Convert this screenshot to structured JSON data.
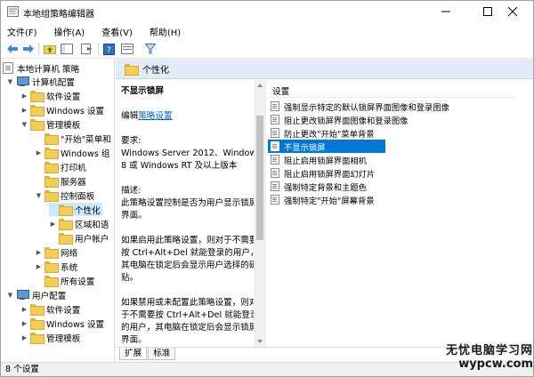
{
  "window": {
    "title": "本地组策略编辑器"
  },
  "menu": [
    "文件(F)",
    "操作(A)",
    "查看(V)",
    "帮助(H)"
  ],
  "tree": {
    "root": "本地计算机 策略",
    "items": [
      {
        "label": "计算机配置"
      },
      {
        "label": "软件设置"
      },
      {
        "label": "Windows 设置"
      },
      {
        "label": "管理模板"
      },
      {
        "label": "\"开始\"菜单和"
      },
      {
        "label": "Windows 组"
      },
      {
        "label": "打印机"
      },
      {
        "label": "服务器"
      },
      {
        "label": "控制面板"
      },
      {
        "label": "个性化"
      },
      {
        "label": "区域和语"
      },
      {
        "label": "用户帐户"
      },
      {
        "label": "网络"
      },
      {
        "label": "系统"
      },
      {
        "label": "所有设置"
      },
      {
        "label": "用户配置"
      },
      {
        "label": "软件设置"
      },
      {
        "label": "Windows 设置"
      },
      {
        "label": "管理模板"
      }
    ]
  },
  "header": {
    "title": "个性化"
  },
  "description": {
    "title": "不显示锁屏",
    "edit_prefix": "编辑",
    "edit_link": "策略设置",
    "requirements_label": "要求:",
    "requirements_text": "Windows Server 2012、Windows 8 或 Windows RT 及以上版本",
    "desc_label": "描述:",
    "desc_text": "此策略设置控制是否为用户显示锁屏界面。",
    "p1": "如果启用此策略设置，则对于不需要按 Ctrl+Alt+Del 就能登录的用户，其电脑在锁定后会显示用户选择的磁贴。",
    "p2": "如果禁用或未配置此策略设置，则对于不需要按 Ctrl+Alt+Del 就能登录的用户，其电脑在锁定后会显示锁屏界面。"
  },
  "list": {
    "column_header": "设置",
    "rows": [
      {
        "label": "强制显示特定的默认锁屏界面图像和登录图像",
        "selected": false
      },
      {
        "label": "阻止更改锁屏界面图像和登录图像",
        "selected": false
      },
      {
        "label": "防止更改\"开始\"菜单背景",
        "selected": false
      },
      {
        "label": "不显示锁屏",
        "selected": true
      },
      {
        "label": "阻止启用锁屏界面相机",
        "selected": false
      },
      {
        "label": "阻止启用锁屏界面幻灯片",
        "selected": false
      },
      {
        "label": "强制特定背景和主题色",
        "selected": false
      },
      {
        "label": "强制特定\"开始\"屏幕背景",
        "selected": false
      }
    ]
  },
  "tabs": [
    "扩展",
    "标准"
  ],
  "status": {
    "text": "8 个设置"
  },
  "watermark": {
    "line1": "无忧电脑学习网",
    "line2": "wypcw.com"
  },
  "colors": {
    "selection": "#0078d7",
    "tree_selection": "#cce8ff",
    "folder": "#f4cc58",
    "link": "#0066cc"
  }
}
